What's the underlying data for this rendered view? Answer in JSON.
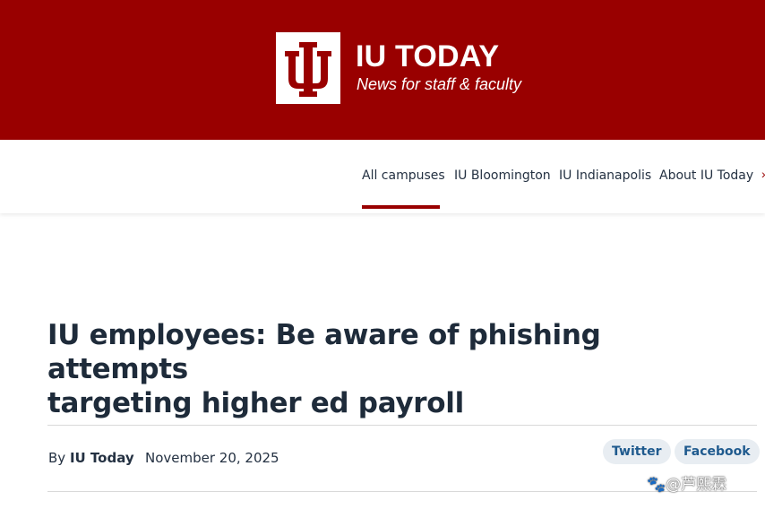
{
  "brand": {
    "title": "IU TODAY",
    "subtitle": "News for staff & faculty",
    "logo_icon": "iu-trident-logo",
    "color": "#990000"
  },
  "nav": {
    "items": [
      {
        "label": "All campuses",
        "active": true
      },
      {
        "label": "IU Bloomington",
        "active": false
      },
      {
        "label": "IU Indianapolis",
        "active": false
      },
      {
        "label": "About IU Today",
        "active": false
      }
    ]
  },
  "article": {
    "headline_line1": "IU employees: Be aware of phishing attempts",
    "headline_line2": "targeting higher ed payroll",
    "byline_prefix": "By",
    "author": "IU Today",
    "date": "November 20, 2025"
  },
  "share": {
    "twitter_label": "Twitter",
    "facebook_label": "Facebook"
  },
  "watermark": "@芦熙霖"
}
